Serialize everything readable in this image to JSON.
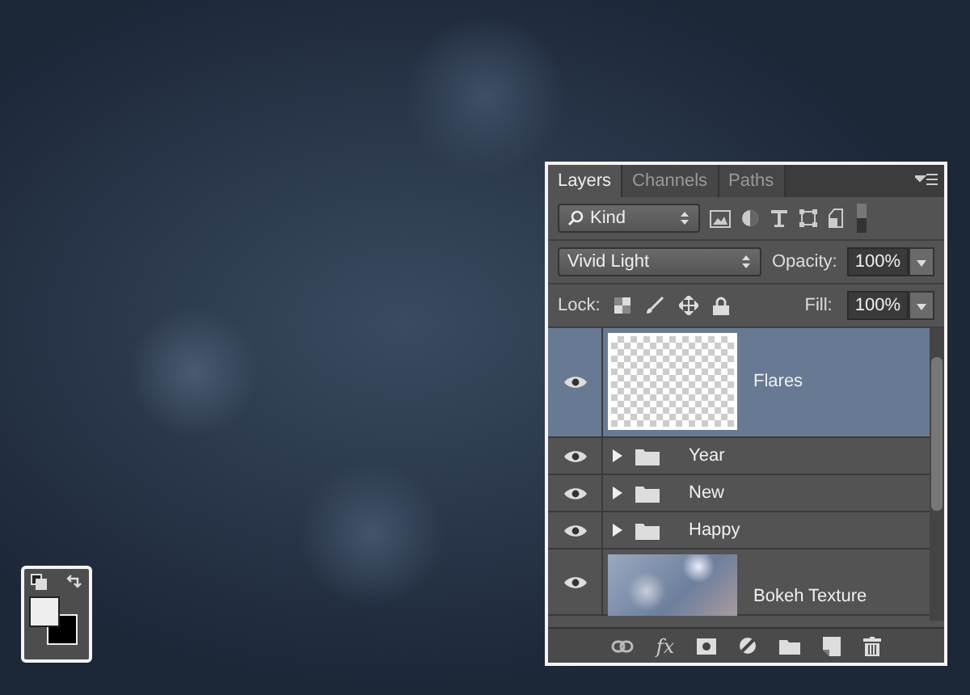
{
  "layers_panel": {
    "tabs": [
      {
        "label": "Layers",
        "selected": true
      },
      {
        "label": "Channels",
        "selected": false
      },
      {
        "label": "Paths",
        "selected": false
      }
    ],
    "filter": {
      "value": "Kind"
    },
    "blend_mode": {
      "value": "Vivid Light"
    },
    "opacity": {
      "label": "Opacity:",
      "value": "100%"
    },
    "lock": {
      "label": "Lock:"
    },
    "fill": {
      "label": "Fill:",
      "value": "100%"
    },
    "layers": [
      {
        "name": "Flares",
        "kind": "pixel",
        "visible": true,
        "selected": true
      },
      {
        "name": "Year",
        "kind": "group",
        "visible": true,
        "selected": false,
        "expanded": false
      },
      {
        "name": "New",
        "kind": "group",
        "visible": true,
        "selected": false,
        "expanded": false
      },
      {
        "name": "Happy",
        "kind": "group",
        "visible": true,
        "selected": false,
        "expanded": false
      },
      {
        "name": "Bokeh Texture",
        "kind": "image",
        "visible": true,
        "selected": false
      }
    ],
    "footer": {
      "fx_label": "fx"
    }
  }
}
